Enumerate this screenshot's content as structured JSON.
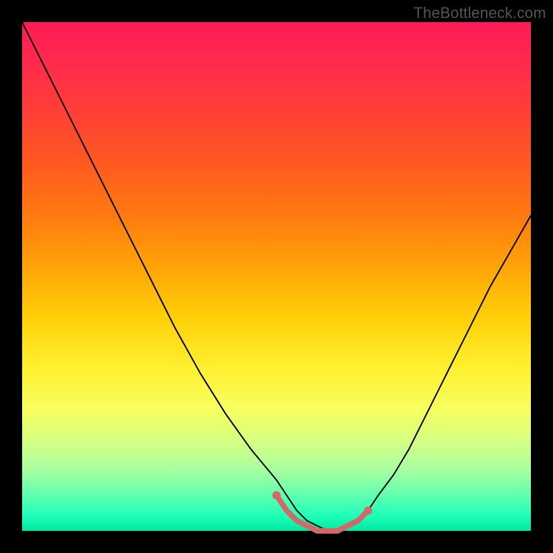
{
  "watermark": "TheBottleneck.com",
  "chart_data": {
    "type": "line",
    "title": "",
    "xlabel": "",
    "ylabel": "",
    "xlim": [
      0,
      100
    ],
    "ylim": [
      0,
      100
    ],
    "grid": false,
    "series": [
      {
        "name": "left-branch",
        "x": [
          0,
          5,
          10,
          15,
          20,
          25,
          30,
          35,
          40,
          45,
          50,
          52,
          54,
          56,
          58,
          60,
          62
        ],
        "y": [
          100,
          90,
          80,
          70,
          60,
          50,
          40,
          31,
          23,
          16,
          10,
          7,
          4,
          2,
          1,
          0,
          0
        ],
        "stroke": "#000000",
        "width": 2
      },
      {
        "name": "right-branch",
        "x": [
          62,
          64,
          66,
          68,
          70,
          73,
          76,
          80,
          84,
          88,
          92,
          96,
          100
        ],
        "y": [
          0,
          1,
          2,
          4,
          7,
          11,
          16,
          24,
          32,
          40,
          48,
          55,
          62
        ],
        "stroke": "#000000",
        "width": 2
      },
      {
        "name": "bottom-indicator",
        "x": [
          50,
          52,
          54,
          56,
          58,
          60,
          62,
          64,
          66,
          68
        ],
        "y": [
          7,
          4,
          2,
          1,
          0,
          0,
          0,
          1,
          2,
          4
        ],
        "stroke": "#d06a6a",
        "width": 8
      }
    ],
    "markers": [
      {
        "name": "left-dot",
        "x": 50,
        "y": 7,
        "r": 6,
        "fill": "#d06a6a"
      },
      {
        "name": "right-dot",
        "x": 68,
        "y": 4,
        "r": 6,
        "fill": "#d06a6a"
      }
    ],
    "background_gradient": {
      "direction": "top-to-bottom",
      "stops": [
        {
          "pos": 0,
          "color": "#ff1a58"
        },
        {
          "pos": 50,
          "color": "#ffcf08"
        },
        {
          "pos": 80,
          "color": "#f8ff60"
        },
        {
          "pos": 100,
          "color": "#00e8a0"
        }
      ]
    }
  }
}
